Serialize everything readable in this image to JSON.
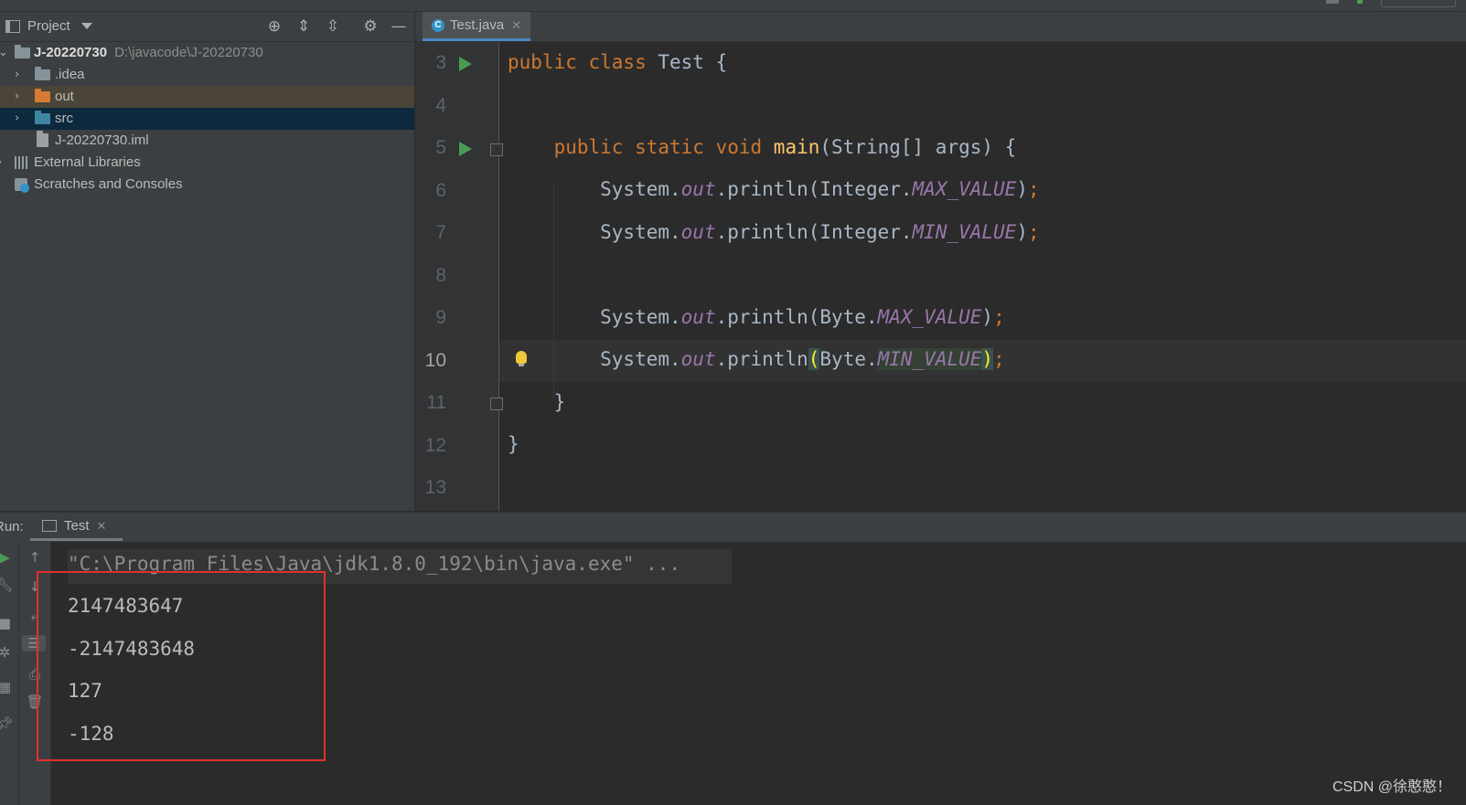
{
  "project_panel": {
    "title": "Project",
    "tree": [
      {
        "label": "J-20220730",
        "path": "D:\\javacode\\J-20220730"
      },
      {
        "label": ".idea"
      },
      {
        "label": "out"
      },
      {
        "label": "src"
      },
      {
        "label": "J-20220730.iml"
      },
      {
        "label": "External Libraries"
      },
      {
        "label": "Scratches and Consoles"
      }
    ]
  },
  "editor": {
    "tab_label": "Test.java",
    "line_numbers": [
      "3",
      "4",
      "5",
      "6",
      "7",
      "8",
      "9",
      "10",
      "11",
      "12",
      "13"
    ],
    "current_line": "10"
  },
  "run_panel": {
    "label": "Run:",
    "tab_label": "Test",
    "command": "\"C:\\Program Files\\Java\\jdk1.8.0_192\\bin\\java.exe\" ...",
    "output": [
      "2147483647",
      "-2147483648",
      "127",
      "-128"
    ]
  },
  "watermark": "CSDN @徐憨憨！",
  "colors": {
    "accent": "#4a88c7",
    "run_green": "#499c54",
    "highlight_red": "#e0302f",
    "keyword": "#cc7832",
    "static_field": "#9876aa",
    "method": "#ffc66d"
  }
}
